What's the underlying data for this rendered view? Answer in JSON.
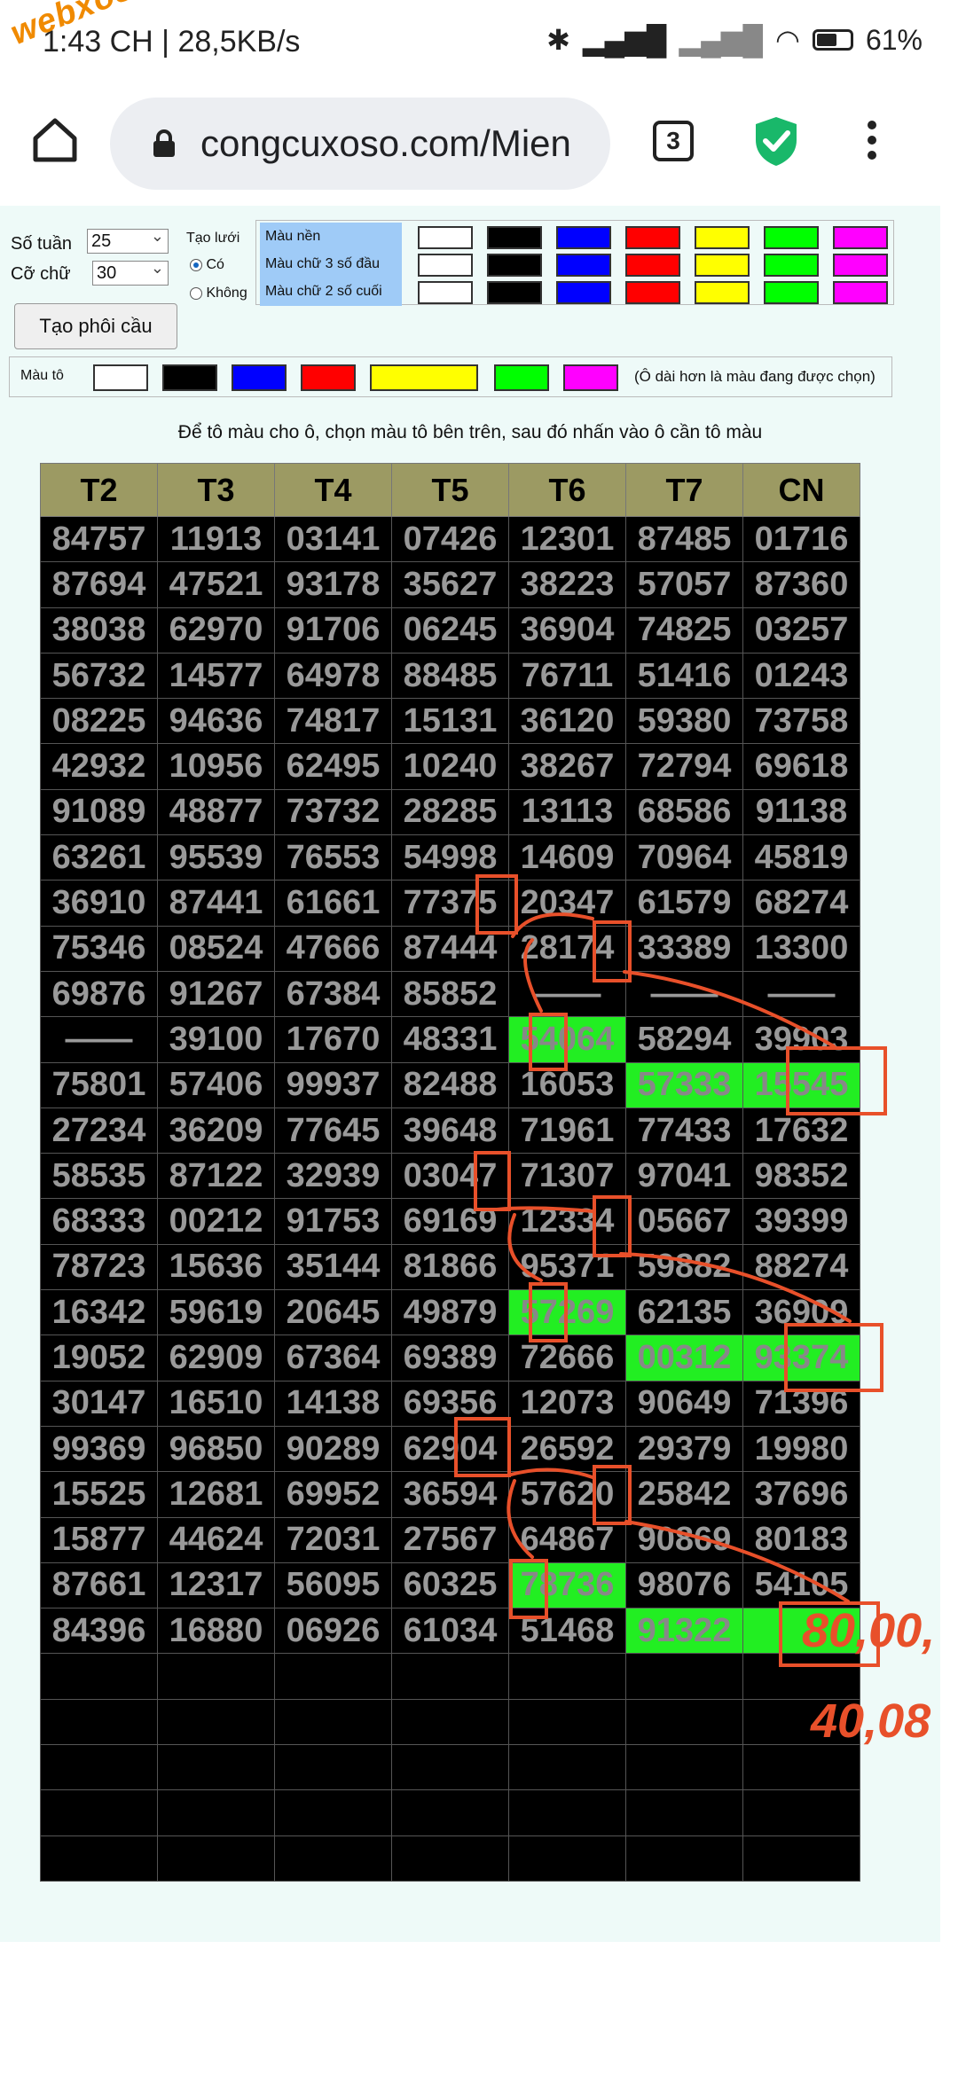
{
  "status_bar": {
    "time": "1:43 CH | 28,5KB/s",
    "battery": "61%",
    "watermark": "webxoso.net"
  },
  "browser": {
    "url": "congcuxoso.com/Mien",
    "tab_count": "3"
  },
  "settings": {
    "so_tuan_label": "Số tuần",
    "so_tuan_value": "25",
    "co_chu_label": "Cỡ chữ",
    "co_chu_value": "30",
    "generate_button": "Tạo phôi cầu",
    "grid_label": "Tạo lưới",
    "grid_yes": "Có",
    "grid_no": "Không"
  },
  "color_rows": [
    {
      "label": "Màu nền"
    },
    {
      "label": "Màu chữ 3 số đầu"
    },
    {
      "label": "Màu chữ 2 số cuối"
    }
  ],
  "swatch_colors": [
    "#ffffff",
    "#000000",
    "#0000ff",
    "#ff0000",
    "#ffff00",
    "#00ff00",
    "#ff00ff"
  ],
  "paint": {
    "label": "Màu tô",
    "note": "(Ô dài hơn là màu đang được chọn)"
  },
  "instruction": "Để tô màu cho ô, chọn màu tô bên trên, sau đó nhấn vào ô cần tô màu",
  "table": {
    "headers": [
      "T2",
      "T3",
      "T4",
      "T5",
      "T6",
      "T7",
      "CN"
    ],
    "rows": [
      [
        "84757",
        "11913",
        "03141",
        "07426",
        "12301",
        "87485",
        "01716"
      ],
      [
        "87694",
        "47521",
        "93178",
        "35627",
        "38223",
        "57057",
        "87360"
      ],
      [
        "38038",
        "62970",
        "91706",
        "06245",
        "36904",
        "74825",
        "03257"
      ],
      [
        "56732",
        "14577",
        "64978",
        "88485",
        "76711",
        "51416",
        "01243"
      ],
      [
        "08225",
        "94636",
        "74817",
        "15131",
        "36120",
        "59380",
        "73758"
      ],
      [
        "42932",
        "10956",
        "62495",
        "10240",
        "38267",
        "72794",
        "69618"
      ],
      [
        "91089",
        "48877",
        "73732",
        "28285",
        "13113",
        "68586",
        "91138"
      ],
      [
        "63261",
        "95539",
        "76553",
        "54998",
        "14609",
        "70964",
        "45819"
      ],
      [
        "36910",
        "87441",
        "61661",
        "77375",
        "20347",
        "61579",
        "68274"
      ],
      [
        "75346",
        "08524",
        "47666",
        "87444",
        "28174",
        "33389",
        "13300"
      ],
      [
        "69876",
        "91267",
        "67384",
        "85852",
        "——",
        "——",
        "——"
      ],
      [
        "——",
        "39100",
        "17670",
        "48331",
        "54064",
        "58294",
        "39903"
      ],
      [
        "75801",
        "57406",
        "99937",
        "82488",
        "16053",
        "57333",
        "15545"
      ],
      [
        "27234",
        "36209",
        "77645",
        "39648",
        "71961",
        "77433",
        "17632"
      ],
      [
        "58535",
        "87122",
        "32939",
        "03047",
        "71307",
        "97041",
        "98352"
      ],
      [
        "68333",
        "00212",
        "91753",
        "69169",
        "12334",
        "05667",
        "39399"
      ],
      [
        "78723",
        "15636",
        "35144",
        "81866",
        "95371",
        "59882",
        "88274"
      ],
      [
        "16342",
        "59619",
        "20645",
        "49879",
        "57269",
        "62135",
        "36909"
      ],
      [
        "19052",
        "62909",
        "67364",
        "69389",
        "72666",
        "00312",
        "93374"
      ],
      [
        "30147",
        "16510",
        "14138",
        "69356",
        "12073",
        "90649",
        "71396"
      ],
      [
        "99369",
        "96850",
        "90289",
        "62904",
        "26592",
        "29379",
        "19980"
      ],
      [
        "15525",
        "12681",
        "69952",
        "36594",
        "57620",
        "25842",
        "37696"
      ],
      [
        "15877",
        "44624",
        "72031",
        "27567",
        "64867",
        "90869",
        "80183"
      ],
      [
        "87661",
        "12317",
        "56095",
        "60325",
        "78736",
        "98076",
        "54105"
      ],
      [
        "84396",
        "16880",
        "06926",
        "61034",
        "51468",
        "91322",
        ""
      ],
      [
        "",
        "",
        "",
        "",
        "",
        "",
        ""
      ],
      [
        "",
        "",
        "",
        "",
        "",
        "",
        ""
      ],
      [
        "",
        "",
        "",
        "",
        "",
        "",
        ""
      ],
      [
        "",
        "",
        "",
        "",
        "",
        "",
        ""
      ],
      [
        "",
        "",
        "",
        "",
        "",
        "",
        ""
      ]
    ]
  },
  "annotations": {
    "line1": "80,00,",
    "line2": "40,08",
    "color": "#e8502a"
  }
}
